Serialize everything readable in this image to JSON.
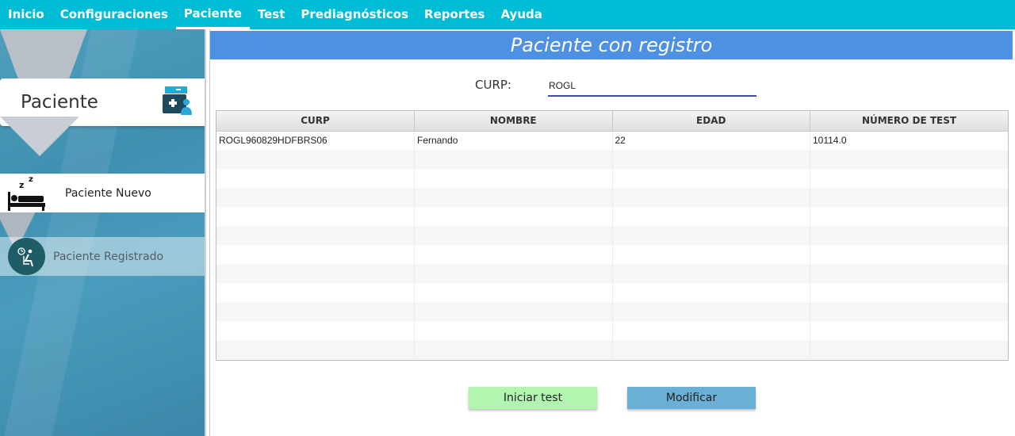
{
  "menu": {
    "items": [
      {
        "label": "Inicio"
      },
      {
        "label": "Configuraciones"
      },
      {
        "label": "Paciente"
      },
      {
        "label": "Test"
      },
      {
        "label": "Prediagnósticos"
      },
      {
        "label": "Reportes"
      },
      {
        "label": "Ayuda"
      }
    ],
    "active": "Paciente"
  },
  "sidebar": {
    "title": "Paciente",
    "items": [
      {
        "label": "Paciente Nuevo",
        "icon": "sleeping-bed-icon"
      },
      {
        "label": "Paciente Registrado",
        "icon": "patient-waiting-icon"
      }
    ]
  },
  "main": {
    "title": "Paciente con registro",
    "search": {
      "label": "CURP:",
      "value": "ROGL"
    },
    "table": {
      "columns": [
        "CURP",
        "NOMBRE",
        "EDAD",
        "NÚMERO DE TEST"
      ],
      "rows": [
        [
          "ROGL960829HDFBRS06",
          "Fernando",
          "22",
          "10114.0"
        ]
      ]
    },
    "buttons": {
      "start": "Iniciar test",
      "modify": "Modificar"
    }
  },
  "colors": {
    "menubar": "#00bcd4",
    "title_bar": "#4e90e2",
    "start_button": "#b2f5b0",
    "modify_button": "#6aafd6"
  }
}
